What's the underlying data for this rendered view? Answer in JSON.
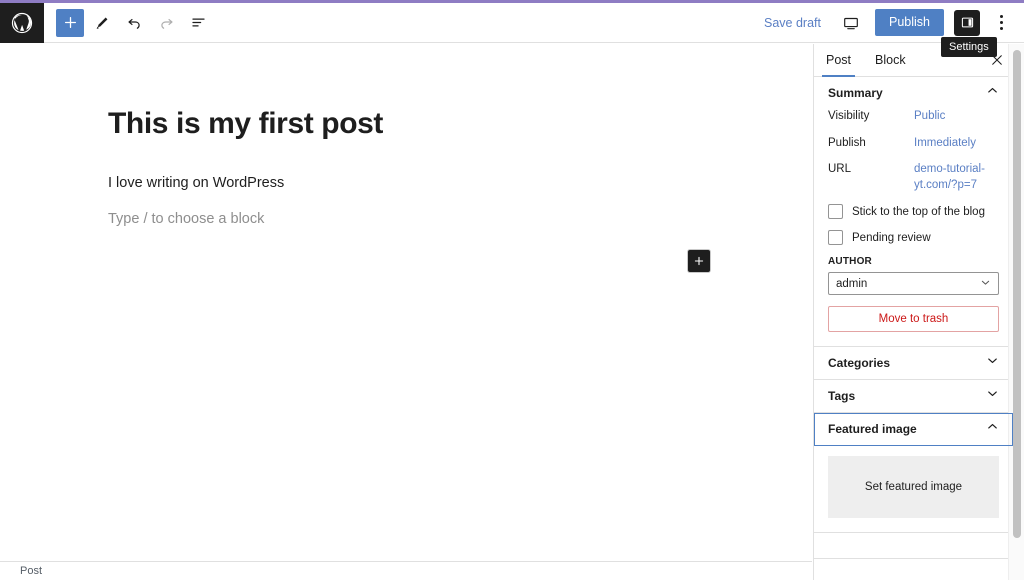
{
  "header": {
    "logo_icon": "wordpress-logo-icon",
    "toolbar_left": [
      {
        "name": "add-block",
        "icon": "plus-icon",
        "active": true
      },
      {
        "name": "tools",
        "icon": "pencil-icon",
        "active": false
      },
      {
        "name": "undo",
        "icon": "undo-icon",
        "active": false
      },
      {
        "name": "redo",
        "icon": "redo-icon",
        "active": false,
        "disabled": true
      },
      {
        "name": "document-overview",
        "icon": "list-view-icon",
        "active": false
      }
    ],
    "save_draft_label": "Save draft",
    "preview_icon": "desktop-preview-icon",
    "publish_label": "Publish",
    "settings_toggle_icon": "sidebar-panel-icon",
    "more_menu_icon": "ellipsis-vertical-icon",
    "tooltip_label": "Settings"
  },
  "editor": {
    "title": "This is my first post",
    "paragraph": "I love writing on WordPress",
    "placeholder": "Type / to choose a block",
    "add_block_icon": "plus-icon"
  },
  "footer": {
    "breadcrumb": "Post"
  },
  "sidebar": {
    "tabs": [
      {
        "label": "Post",
        "active": true
      },
      {
        "label": "Block",
        "active": false
      }
    ],
    "close_icon": "close-icon",
    "summary": {
      "title": "Summary",
      "chevron": "chevron-up-icon",
      "rows": [
        {
          "label": "Visibility",
          "value": "Public"
        },
        {
          "label": "Publish",
          "value": "Immediately"
        },
        {
          "label": "URL",
          "value": "demo-tutorial-yt.com/?p=7"
        }
      ],
      "checkboxes": [
        {
          "label": "Stick to the top of the blog",
          "checked": false
        },
        {
          "label": "Pending review",
          "checked": false
        }
      ],
      "author_label": "AUTHOR",
      "author_value": "admin",
      "trash_label": "Move to trash"
    },
    "panels": [
      {
        "title": "Categories",
        "chevron": "chevron-down-icon",
        "expanded": false
      },
      {
        "title": "Tags",
        "chevron": "chevron-down-icon",
        "expanded": false
      },
      {
        "title": "Featured image",
        "chevron": "chevron-up-icon",
        "expanded": true,
        "focused": true
      }
    ],
    "featured_image_placeholder": "Set featured image"
  },
  "colors": {
    "accent_blue": "#4f80c4",
    "link_blue": "#5a7fc4",
    "dark": "#1e1e1e",
    "danger_red": "#cc1818",
    "top_accent": "#8e7cc3"
  }
}
